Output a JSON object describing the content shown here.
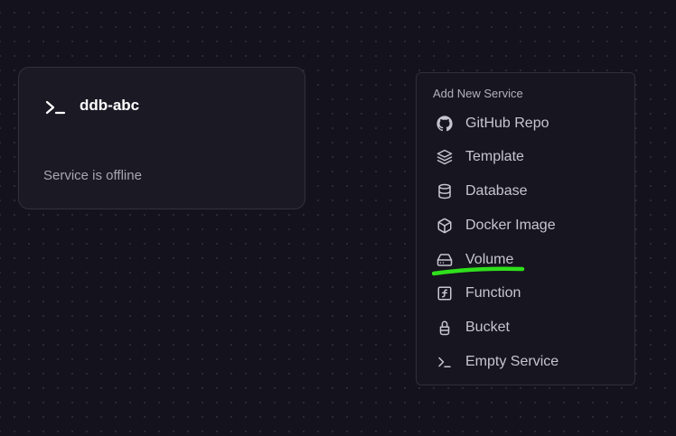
{
  "canvas": {
    "service_card": {
      "icon": "terminal-icon",
      "name": "ddb-abc",
      "status": "Service is offline"
    }
  },
  "add_service_menu": {
    "title": "Add New Service",
    "items": [
      {
        "label": "GitHub Repo",
        "icon": "github-icon"
      },
      {
        "label": "Template",
        "icon": "layers-icon"
      },
      {
        "label": "Database",
        "icon": "database-icon"
      },
      {
        "label": "Docker Image",
        "icon": "box-icon"
      },
      {
        "label": "Volume",
        "icon": "hard-drive-icon"
      },
      {
        "label": "Function",
        "icon": "function-icon"
      },
      {
        "label": "Bucket",
        "icon": "bucket-icon"
      },
      {
        "label": "Empty Service",
        "icon": "terminal-icon"
      }
    ]
  },
  "annotation": {
    "color": "#2fe01c"
  }
}
